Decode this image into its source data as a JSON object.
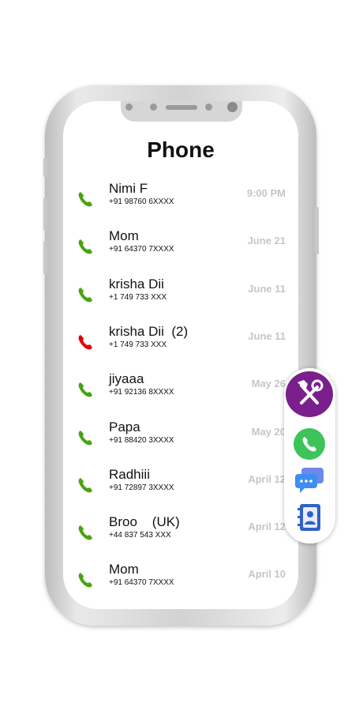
{
  "app": {
    "title": "Phone"
  },
  "calls": [
    {
      "name": "Nimi F",
      "number": "+91 98760 6XXXX",
      "time": "9:00 PM",
      "type": "received"
    },
    {
      "name": "Mom",
      "number": "+91 64370 7XXXX",
      "time": "June 21",
      "type": "received"
    },
    {
      "name": "krisha Dii",
      "number": "+1 749 733 XXX",
      "time": "June 11",
      "type": "received"
    },
    {
      "name": "krisha Dii  (2)",
      "number": "+1 749 733 XXX",
      "time": "June 11",
      "type": "missed"
    },
    {
      "name": "jiyaaa",
      "number": "+91 92136 8XXXX",
      "time": "May 26",
      "type": "received"
    },
    {
      "name": "Papa",
      "number": "+91 88420 3XXXX",
      "time": "May 20",
      "type": "received"
    },
    {
      "name": "Radhiii",
      "number": "+91 72897 3XXXX",
      "time": "April 12",
      "type": "received"
    },
    {
      "name": "Broo    (UK)",
      "number": "+44 837 543 XXX",
      "time": "April 12",
      "type": "received"
    },
    {
      "name": "Mom",
      "number": "+91 64370 7XXXX",
      "time": "April 10",
      "type": "received"
    }
  ],
  "colors": {
    "received": "#4aa312",
    "missed": "#e00000",
    "accent": "#7a1f8c",
    "time": "#c6c6c6"
  },
  "dock": {
    "icons": [
      "tools-icon",
      "phone-icon",
      "messages-icon",
      "contacts-icon"
    ]
  }
}
